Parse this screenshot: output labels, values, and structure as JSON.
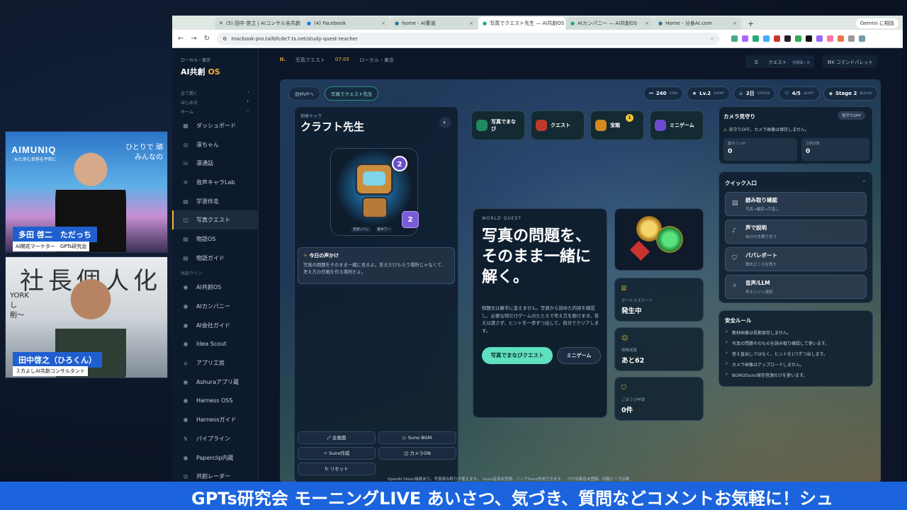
{
  "cams": {
    "cam1": {
      "brand": "AIMUNIQ",
      "brand_sub": "AIと歩む世界を平和に",
      "tag_line1": "ひとりで 頑",
      "tag_line2": "みんなの",
      "name": "多田 啓二　ただっち",
      "role": "AI開花マーケター　GPTs研究会"
    },
    "cam2": {
      "bg_text": "社長個人化",
      "bg_side1": "YORK",
      "bg_side2": "し",
      "bg_side3": "削〜",
      "name": "田中啓之（ひろくん）",
      "role": "３方よしAI共創コンサルタント"
    }
  },
  "browser": {
    "tabs": [
      {
        "label": "(5) 田中 啓之 | AIコンサル全共創"
      },
      {
        "label": "(4) Facebook"
      },
      {
        "label": "home - AI集道"
      },
      {
        "label": "写真でクエスト先生 — AI共創OS"
      },
      {
        "label": "AIカンパニー — AI共創OS"
      },
      {
        "label": "Home - 分身AI.com"
      }
    ],
    "gemini": "Gemini に相談",
    "url": "macbook-pro.tailbfcde7.ts.net/study-quest-teacher"
  },
  "sidebar": {
    "region": "ローカル・東京",
    "logo_main": "AI共創",
    "logo_os": "OS",
    "mini": [
      {
        "label": "全て開く"
      },
      {
        "label": "はじめる"
      },
      {
        "label": "ホーム"
      }
    ],
    "items": [
      {
        "icon": "grid-icon",
        "glyph": "▦",
        "label": "ダッシュボード"
      },
      {
        "icon": "chat-icon",
        "glyph": "◎",
        "label": "凛ちゃん"
      },
      {
        "icon": "phone-icon",
        "glyph": "☏",
        "label": "凛通話"
      },
      {
        "icon": "wave-icon",
        "glyph": "≋",
        "label": "音声キャラLab"
      },
      {
        "icon": "book-icon",
        "glyph": "▤",
        "label": "学習伴走"
      },
      {
        "icon": "camera-icon",
        "glyph": "◫",
        "label": "写真クエスト"
      },
      {
        "icon": "book-icon",
        "glyph": "▤",
        "label": "物語OS"
      },
      {
        "icon": "book-icon",
        "glyph": "▤",
        "label": "物語ガイド"
      }
    ],
    "section_label": "共創ライン",
    "items2": [
      {
        "icon": "os-icon",
        "glyph": "◉",
        "label": "AI共創OS"
      },
      {
        "icon": "company-icon",
        "glyph": "◉",
        "label": "AIカンパニー"
      },
      {
        "icon": "guide-icon",
        "glyph": "◉",
        "label": "AI会社ガイド"
      },
      {
        "icon": "scout-icon",
        "glyph": "◉",
        "label": "Idea Scout"
      },
      {
        "icon": "factory-icon",
        "glyph": "⌂",
        "label": "アプリ工房"
      },
      {
        "icon": "ashura-icon",
        "glyph": "◉",
        "label": "Ashuraアプリ蔵"
      },
      {
        "icon": "harness-icon",
        "glyph": "◉",
        "label": "Harness OSS"
      },
      {
        "icon": "harness-guide-icon",
        "glyph": "◉",
        "label": "Harnessガイド"
      },
      {
        "icon": "pipeline-icon",
        "glyph": "↯",
        "label": "パイプライン"
      },
      {
        "icon": "paperclip-icon",
        "glyph": "◉",
        "label": "Paperclip内蔵"
      },
      {
        "icon": "radar-icon",
        "glyph": "◎",
        "label": "共創レーダー"
      }
    ]
  },
  "header": {
    "num": "II.",
    "page": "写真クエスト",
    "time": "07:05",
    "loc": "ローカル・東京",
    "quest_btn": "クエスト",
    "quest_sub": "背景図 / 大",
    "cmd_btn": "⌘K コマンドパレット"
  },
  "canvas": {
    "chips": [
      {
        "label": "旧MVPへ"
      },
      {
        "label": "写真でクエスト先生"
      }
    ],
    "stats": [
      {
        "icon": "link-icon",
        "glyph": "⚯",
        "value": "240",
        "unit": "COIN"
      },
      {
        "icon": "star-icon",
        "glyph": "★",
        "value": "Lv.2",
        "unit": "100XP"
      },
      {
        "icon": "fire-icon",
        "glyph": "♨",
        "value": "2日",
        "unit": "STREAK"
      },
      {
        "icon": "heart-icon",
        "glyph": "♡",
        "value": "4/5",
        "unit": "HEART"
      },
      {
        "icon": "stage-icon",
        "glyph": "◈",
        "value": "Stage 2",
        "unit": "BLOCKY"
      }
    ],
    "character": {
      "small_label": "相棒キャラ",
      "name": "クラフト先生",
      "level_badge": "2",
      "tags": [
        "見習いバッ",
        "集中ブー"
      ],
      "message_title": "今日の声かけ",
      "message_body": "写真の問題をそのまま一緒に見るよ。答えだけもらう場所じゃなくて、考え方の作戦を作る場所だよ。",
      "buttons": [
        {
          "icon": "expand-icon",
          "glyph": "⤢",
          "label": "全画面"
        },
        {
          "icon": "play-icon",
          "glyph": "▷",
          "label": "Suno BGM"
        },
        {
          "icon": "sparkle-icon",
          "glyph": "✧",
          "label": "Suno作成"
        },
        {
          "icon": "camera-icon",
          "glyph": "◫",
          "label": "カメラON"
        },
        {
          "icon": "reset-icon",
          "glyph": "↻",
          "label": "リセット"
        }
      ]
    },
    "categories": [
      {
        "label": "写真でまなび",
        "color": "#1f8a5f"
      },
      {
        "label": "クエスト",
        "color": "#c0392b"
      },
      {
        "label": "宝箱",
        "color": "#d38b1f",
        "badge": "1"
      },
      {
        "label": "ミニゲーム",
        "color": "#6c4bd1"
      }
    ],
    "hero": {
      "eyebrow": "WORLD QUEST",
      "title": "写真の問題を、そのまま一緒に解く。",
      "desc": "問題文は勝手に変えません。写真から読めた内容を確認し、必要な時だけゲームのたとえで考え方を助けます。答えは渡さず、ヒントを一歩ずつ出して、自分でクリアします。",
      "cta": "写真でまなびクエスト",
      "cta2": "ミニゲーム"
    },
    "mini_cards": [
      {
        "icon": "gift-icon",
        "glyph": "⛝",
        "label": "ボーナスステージ",
        "value": "発生中"
      },
      {
        "icon": "robot-icon",
        "glyph": "☺",
        "label": "相棒成長",
        "value": "あと62"
      },
      {
        "icon": "shield-icon",
        "glyph": "⛉",
        "label": "ごほうび申請",
        "value": "0件"
      }
    ],
    "camera": {
      "title": "カメラ見守り",
      "toggle": "見守りOFF",
      "note": "見守りOFF。カメラ画像は保存しません。",
      "boxes": [
        {
          "label": "集中コンボ",
          "value": "0"
        },
        {
          "label": "注意回数",
          "value": "0"
        }
      ]
    },
    "quick": {
      "title": "クイック入口",
      "items": [
        {
          "icon": "book-icon",
          "glyph": "▤",
          "title": "読み取り確認",
          "sub": "写真→確認→手直し"
        },
        {
          "icon": "mic-icon",
          "glyph": "♪",
          "title": "声で説明",
          "sub": "自分の言葉で言う"
        },
        {
          "icon": "shield-icon",
          "glyph": "⛉",
          "title": "パパレポート",
          "sub": "褒めどころを残す"
        },
        {
          "icon": "wand-icon",
          "glyph": "✧",
          "title": "音声/LLM",
          "sub": "声エンジン選択"
        }
      ]
    },
    "rules": {
      "title": "安全ルール",
      "items": [
        "教材画像は長期保存しません。",
        "写真の問題そのものを読み取り確認して使います。",
        "答え直出しではなく、ヒントを1つずつ出します。",
        "カメラ画像はアップロードしません。",
        "BGMはSuno保存音源だけを使います。"
      ]
    },
    "footnote": "OpenAI Vision接続あり。写真読み取りが使えます。 ·Suno音源未登録。ここでSuno作成できます。 ·プロ効果音未登録。内蔵ビープは鳴"
  },
  "ticker": "GPTs研究会 モーニングLIVE あいさつ、気づき、質問などコメントお気軽に！シュ"
}
